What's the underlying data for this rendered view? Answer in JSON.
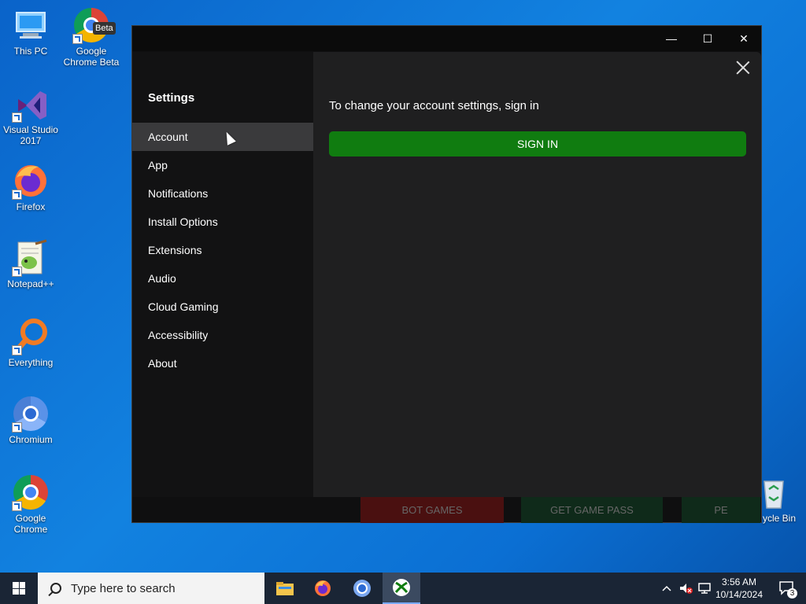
{
  "desktop": {
    "icons": [
      {
        "label": "This PC",
        "icon": "this-pc-icon"
      },
      {
        "label": "Google Chrome Beta",
        "badge": "Beta",
        "icon": "chrome-beta-icon"
      },
      {
        "label": "Visual Studio 2017",
        "icon": "visual-studio-icon"
      },
      {
        "label": "Firefox",
        "icon": "firefox-icon"
      },
      {
        "label": "Notepad++",
        "icon": "notepad-plus-plus-icon"
      },
      {
        "label": "Everything",
        "icon": "everything-search-icon"
      },
      {
        "label": "Chromium",
        "icon": "chromium-icon"
      },
      {
        "label": "Google Chrome",
        "icon": "chrome-icon"
      },
      {
        "label": "Recycle Bin",
        "visible_label": "ycle Bin",
        "icon": "recycle-bin-icon"
      }
    ]
  },
  "window": {
    "controls": {
      "minimize": "—",
      "maximize": "☐",
      "close": "✕"
    },
    "background_strip": [
      "BOT GAMES",
      "GET GAME PASS",
      "PE"
    ]
  },
  "settings": {
    "title": "Settings",
    "nav": [
      {
        "label": "Account",
        "active": true
      },
      {
        "label": "App"
      },
      {
        "label": "Notifications"
      },
      {
        "label": "Install Options"
      },
      {
        "label": "Extensions"
      },
      {
        "label": "Audio"
      },
      {
        "label": "Cloud Gaming"
      },
      {
        "label": "Accessibility"
      },
      {
        "label": "About"
      }
    ],
    "content": {
      "message": "To change your account settings, sign in",
      "signin_label": "SIGN IN"
    },
    "colors": {
      "accent": "#107c10",
      "sidebar": "#121213",
      "content": "#1f1f20",
      "active_item": "#3a3a3c"
    }
  },
  "taskbar": {
    "search_placeholder": "Type here to search",
    "apps": [
      "file-explorer-icon",
      "firefox-icon",
      "chromium-icon",
      "xbox-icon"
    ],
    "clock": {
      "time": "3:56 AM",
      "date": "10/14/2024"
    },
    "notification_count": "3"
  }
}
